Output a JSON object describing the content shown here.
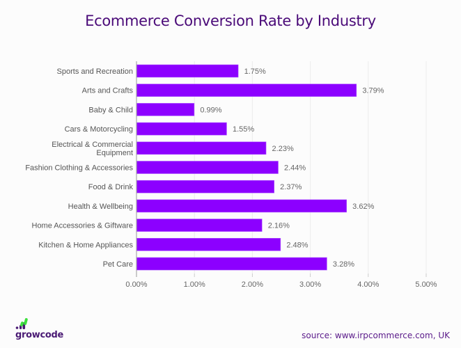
{
  "chart_data": {
    "type": "bar",
    "orientation": "horizontal",
    "title": "Ecommerce Conversion Rate by Industry",
    "xlabel": "",
    "ylabel": "",
    "categories": [
      "Sports and Recreation",
      "Arts and Crafts",
      "Baby & Child",
      "Cars & Motorcycling",
      "Electrical & Commercial Equipment",
      "Fashion Clothing & Accessories",
      "Food & Drink",
      "Health & Wellbeing",
      "Home Accessories & Giftware",
      "Kitchen & Home Appliances",
      "Pet Care"
    ],
    "category_lines": [
      [
        "Sports and Recreation"
      ],
      [
        "Arts and Crafts"
      ],
      [
        "Baby & Child"
      ],
      [
        "Cars & Motorcycling"
      ],
      [
        "Electrical & Commercial",
        "Equipment"
      ],
      [
        "Fashion Clothing & Accessories"
      ],
      [
        "Food & Drink"
      ],
      [
        "Health & Wellbeing"
      ],
      [
        "Home Accessories & Giftware"
      ],
      [
        "Kitchen & Home Appliances"
      ],
      [
        "Pet Care"
      ]
    ],
    "values": [
      1.75,
      3.79,
      0.99,
      1.55,
      2.23,
      2.44,
      2.37,
      3.62,
      2.16,
      2.48,
      3.28
    ],
    "value_labels": [
      "1.75%",
      "3.79%",
      "0.99%",
      "1.55%",
      "2.23%",
      "2.44%",
      "2.37%",
      "3.62%",
      "2.16%",
      "2.48%",
      "3.28%"
    ],
    "xlim": [
      0,
      5
    ],
    "xticks": [
      0,
      1,
      2,
      3,
      4,
      5
    ],
    "xtick_labels": [
      "0.00%",
      "1.00%",
      "2.00%",
      "3.00%",
      "4.00%",
      "5.00%"
    ],
    "grid": true,
    "legend": "none",
    "bar_color": "#8c00ff"
  },
  "branding": {
    "logo_text": "growcode",
    "logo_icon": "signal-bars-icon",
    "dot_color": "#4a1a74",
    "accent_color": "#3de03d"
  },
  "source": "source: www.irpcommerce.com, UK"
}
